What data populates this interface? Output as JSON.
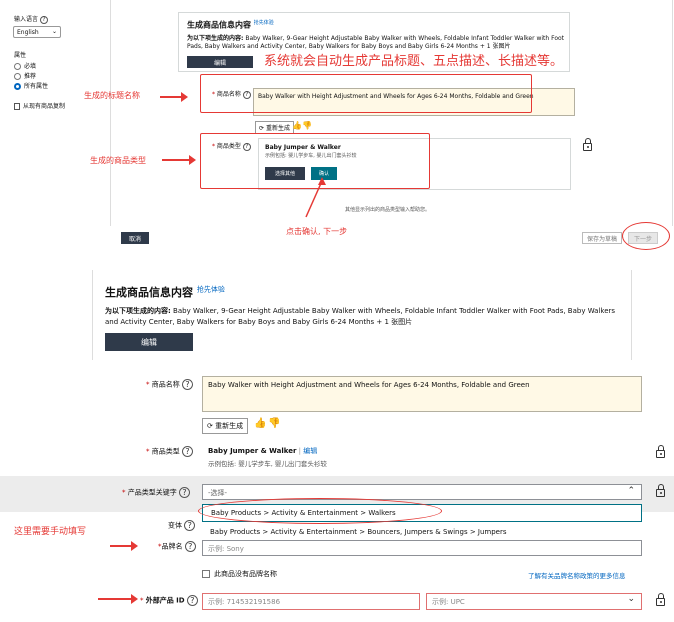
{
  "top": {
    "sidebar": {
      "input_language_label": "输入语言",
      "language_value": "English",
      "attributes_label": "属性",
      "options": [
        "必填",
        "推荐",
        "所有属性"
      ],
      "copy_existing": "从现有商品复制"
    },
    "gen": {
      "title": "生成商品信息内容",
      "beta": "抢先体验",
      "prefix": "为以下项生成的内容:",
      "text": "Baby Walker, 9-Gear Height Adjustable Baby Walker with Wheels, Foldable Infant Toddler Walker with Foot Pads, Baby Walkers and Activity Center, Baby Walkers for Baby Boys and Baby Girls 6-24 Months + 1 张图片",
      "edit_btn": "编辑"
    },
    "product_name_label": "商品名称",
    "product_name_value": "Baby Walker with Height Adjustment and Wheels for Ages 6-24 Months, Foldable and Green",
    "regenerate": "重新生成",
    "product_type_label": "商品类型",
    "type_title": "Baby Jumper & Walker",
    "type_examples": "示例包括: 婴儿学步车, 婴儿出门套头衫较",
    "select_other": "选择其他",
    "confirm": "确认",
    "helper_text": "其他显示列出的商品类型输入帮助您。",
    "cancel": "取消",
    "save_draft": "保存为草稿",
    "next": "下一步",
    "annotations": {
      "banner": "系统就会自动生成产品标题、五点描述、长描述等。",
      "title_note": "生成的标题名称",
      "type_note": "生成的商品类型",
      "click_note": "点击确认, 下一步"
    }
  },
  "bottom": {
    "gen": {
      "title": "生成商品信息内容",
      "beta": "抢先体验",
      "prefix": "为以下项生成的内容:",
      "text": "Baby Walker, 9-Gear Height Adjustable Baby Walker with Wheels, Foldable Infant Toddler Walker with Foot Pads, Baby Walkers and Activity Center, Baby Walkers for Baby Boys and Baby Girls 6-24 Months + 1 张图片",
      "edit_btn": "编辑"
    },
    "product_name_label": "商品名称",
    "product_name_value": "Baby Walker with Height Adjustment and Wheels for Ages 6-24 Months, Foldable and Green",
    "regenerate": "重新生成",
    "product_type_label": "商品类型",
    "type_title": "Baby Jumper & Walker",
    "type_edit": "编辑",
    "type_examples": "示例包括: 婴儿学步车, 婴儿出门套头衫较",
    "keyword_label": "产品类型关键字",
    "keyword_placeholder": "-选择-",
    "keyword_options": [
      "Baby Products > Activity & Entertainment > Walkers",
      "Baby Products > Activity & Entertainment > Bouncers, Jumpers & Swings > Jumpers"
    ],
    "variant_label": "变体",
    "brand_label": "品牌名",
    "brand_placeholder": "示例: Sony",
    "no_brand": "此商品没有品牌名称",
    "brand_policy_link": "了解有关品牌名称政策的更多信息",
    "external_id_label": "外部产品 ID",
    "external_id_placeholder": "示例: 714532191586",
    "id_type_placeholder": "示例: UPC",
    "annotation": "这里需要手动填写"
  }
}
